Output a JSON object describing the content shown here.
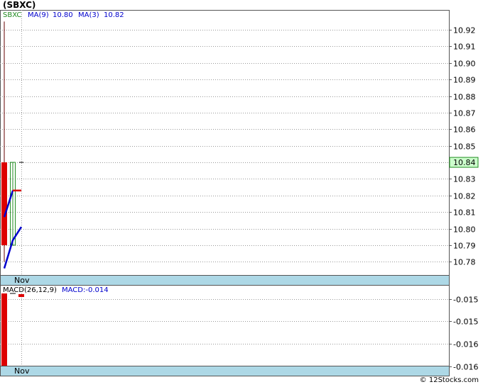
{
  "title": "(SBXC)",
  "footer": "© 12Stocks.com",
  "chart_data": [
    {
      "type": "candlestick",
      "legend": {
        "symbol": "SBXC",
        "ma9_label": "MA(9)",
        "ma9_value": "10.80",
        "ma3_label": "MA(3)",
        "ma3_value": "10.82"
      },
      "ylim": [
        10.772,
        10.932
      ],
      "y_ticks": [
        "10.92",
        "10.91",
        "10.90",
        "10.89",
        "10.88",
        "10.87",
        "10.86",
        "10.85",
        "10.84",
        "10.83",
        "10.82",
        "10.81",
        "10.80",
        "10.79",
        "10.78"
      ],
      "x_label": "Nov",
      "last_price": "10.84",
      "candles": [
        {
          "open": 10.84,
          "close": 10.79,
          "high": 10.925,
          "low": 10.78,
          "color": "down"
        },
        {
          "open": 10.79,
          "close": 10.84,
          "high": 10.84,
          "low": 10.79,
          "color": "up"
        },
        {
          "open": 10.84,
          "close": 10.84,
          "high": 10.84,
          "low": 10.84,
          "color": "flat"
        }
      ],
      "ma9": [
        10.776,
        10.793,
        10.801
      ],
      "ma3": [
        10.807,
        10.823,
        10.823
      ],
      "colors": {
        "up": "#228B22",
        "down": "#dd0000",
        "ma9": "#0000cc",
        "ma3": "#0000cc",
        "ma_last": "#dd0000",
        "price_box": "#ccffcc",
        "axis_band": "#add8e6"
      }
    },
    {
      "type": "bar",
      "legend": {
        "label": "MACD(26,12,9)",
        "value_label": "MACD:-0.014"
      },
      "ylim": [
        -0.01624,
        -0.01444
      ],
      "y_ticks": [
        "-0.015",
        "-0.015",
        "-0.016",
        "-0.016"
      ],
      "y_tick_values": [
        -0.01475,
        -0.01525,
        -0.01575,
        -0.01625
      ],
      "x_label": "Nov",
      "bars": [
        -0.01624,
        -0.0145,
        -0.0145
      ],
      "colors": {
        "bar": "#dd0000"
      }
    }
  ]
}
